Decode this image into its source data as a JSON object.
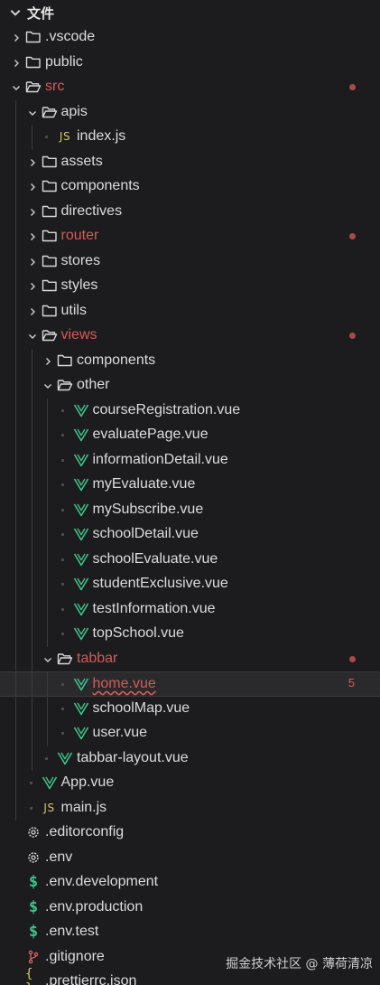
{
  "explorer": {
    "title": "文件"
  },
  "tree": [
    {
      "label": ".vscode",
      "kind": "folder",
      "depth": 0,
      "open": false,
      "status": "normal"
    },
    {
      "label": "public",
      "kind": "folder",
      "depth": 0,
      "open": false,
      "status": "normal"
    },
    {
      "label": "src",
      "kind": "folder",
      "depth": 0,
      "open": true,
      "status": "modified",
      "dot": true
    },
    {
      "label": "apis",
      "kind": "folder",
      "depth": 1,
      "open": true,
      "status": "normal"
    },
    {
      "label": "index.js",
      "kind": "js",
      "depth": 2,
      "status": "normal"
    },
    {
      "label": "assets",
      "kind": "folder",
      "depth": 1,
      "open": false,
      "status": "normal"
    },
    {
      "label": "components",
      "kind": "folder",
      "depth": 1,
      "open": false,
      "status": "normal"
    },
    {
      "label": "directives",
      "kind": "folder",
      "depth": 1,
      "open": false,
      "status": "normal"
    },
    {
      "label": "router",
      "kind": "folder",
      "depth": 1,
      "open": false,
      "status": "modified",
      "dot": true
    },
    {
      "label": "stores",
      "kind": "folder",
      "depth": 1,
      "open": false,
      "status": "normal"
    },
    {
      "label": "styles",
      "kind": "folder",
      "depth": 1,
      "open": false,
      "status": "normal"
    },
    {
      "label": "utils",
      "kind": "folder",
      "depth": 1,
      "open": false,
      "status": "normal"
    },
    {
      "label": "views",
      "kind": "folder",
      "depth": 1,
      "open": true,
      "status": "modified",
      "dot": true
    },
    {
      "label": "components",
      "kind": "folder",
      "depth": 2,
      "open": false,
      "status": "normal"
    },
    {
      "label": "other",
      "kind": "folder",
      "depth": 2,
      "open": true,
      "status": "normal"
    },
    {
      "label": "courseRegistration.vue",
      "kind": "vue",
      "depth": 3,
      "status": "normal"
    },
    {
      "label": "evaluatePage.vue",
      "kind": "vue",
      "depth": 3,
      "status": "normal"
    },
    {
      "label": "informationDetail.vue",
      "kind": "vue",
      "depth": 3,
      "status": "normal"
    },
    {
      "label": "myEvaluate.vue",
      "kind": "vue",
      "depth": 3,
      "status": "normal"
    },
    {
      "label": "mySubscribe.vue",
      "kind": "vue",
      "depth": 3,
      "status": "normal"
    },
    {
      "label": "schoolDetail.vue",
      "kind": "vue",
      "depth": 3,
      "status": "normal"
    },
    {
      "label": "schoolEvaluate.vue",
      "kind": "vue",
      "depth": 3,
      "status": "normal"
    },
    {
      "label": "studentExclusive.vue",
      "kind": "vue",
      "depth": 3,
      "status": "normal"
    },
    {
      "label": "testInformation.vue",
      "kind": "vue",
      "depth": 3,
      "status": "normal"
    },
    {
      "label": "topSchool.vue",
      "kind": "vue",
      "depth": 3,
      "status": "normal"
    },
    {
      "label": "tabbar",
      "kind": "folder",
      "depth": 2,
      "open": true,
      "status": "modified",
      "dot": true
    },
    {
      "label": "home.vue",
      "kind": "vue",
      "depth": 3,
      "status": "error",
      "badge": "5",
      "active": true
    },
    {
      "label": "schoolMap.vue",
      "kind": "vue",
      "depth": 3,
      "status": "normal"
    },
    {
      "label": "user.vue",
      "kind": "vue",
      "depth": 3,
      "status": "normal"
    },
    {
      "label": "tabbar-layout.vue",
      "kind": "vue",
      "depth": 2,
      "status": "normal"
    },
    {
      "label": "App.vue",
      "kind": "vue",
      "depth": 1,
      "status": "normal"
    },
    {
      "label": "main.js",
      "kind": "js",
      "depth": 1,
      "status": "normal"
    },
    {
      "label": ".editorconfig",
      "kind": "gear",
      "depth": 0,
      "status": "normal"
    },
    {
      "label": ".env",
      "kind": "gear",
      "depth": 0,
      "status": "normal"
    },
    {
      "label": ".env.development",
      "kind": "dollar",
      "depth": 0,
      "status": "normal"
    },
    {
      "label": ".env.production",
      "kind": "dollar",
      "depth": 0,
      "status": "normal"
    },
    {
      "label": ".env.test",
      "kind": "dollar",
      "depth": 0,
      "status": "normal"
    },
    {
      "label": ".gitignore",
      "kind": "git",
      "depth": 0,
      "status": "normal"
    },
    {
      "label": ".prettierrc.json",
      "kind": "json",
      "depth": 0,
      "status": "normal"
    }
  ],
  "icons": {
    "js": "JS",
    "dollar": "$",
    "json": "{ }"
  },
  "watermark": "掘金技术社区 @ 薄荷清凉",
  "colors": {
    "background": "#1c1c1e",
    "text": "#dcdcdc",
    "modified": "#d55a5a",
    "vue": "#3ec38a",
    "js": "#d9c46a"
  }
}
